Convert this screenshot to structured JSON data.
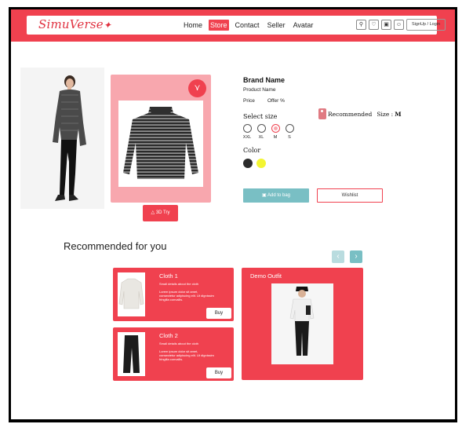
{
  "header": {
    "logo": "SimuVerse",
    "nav": [
      "Home",
      "Store",
      "Contact",
      "Seller",
      "Avatar"
    ],
    "active_nav": "Store",
    "icons": [
      "search-icon",
      "heart-icon",
      "bag-icon",
      "user-icon"
    ],
    "signup_label": "SignUp / Login"
  },
  "product": {
    "brand": "Brand Name",
    "name": "Product Name",
    "price_label": "Price",
    "offer_label": "Offer %",
    "select_size_label": "Select size",
    "sizes": [
      "XXL",
      "XL",
      "M",
      "S"
    ],
    "selected_size": "M",
    "color_label": "Color",
    "colors": [
      "#2b2b2b",
      "#f3f532"
    ],
    "recommended_label": "Recommended",
    "recommended_size_label": "Size :",
    "recommended_size_value": "M",
    "add_to_bag_label": "Add to bag",
    "wishlist_label": "Wishlist",
    "try_label": "3D Try"
  },
  "recommended": {
    "title": "Recommended for you",
    "items": [
      {
        "name": "Cloth 1",
        "subtitle": "Small details about the cloth",
        "description": "Lorem ipsum dolor sit amet, consectetur adipiscing elit. Ut dignissim fringilla convallis.",
        "buy_label": "Buy"
      },
      {
        "name": "Cloth 2",
        "subtitle": "Small details about the cloth",
        "description": "Lorem ipsum dolor sit amet, consectetur adipiscing elit. Ut dignissim fringilla convallis.",
        "buy_label": "Buy"
      }
    ],
    "outfit_title": "Demo Outfit"
  },
  "colors": {
    "accent": "#f0414f",
    "accent_light": "#f8a7ae",
    "teal": "#79bfc4"
  }
}
